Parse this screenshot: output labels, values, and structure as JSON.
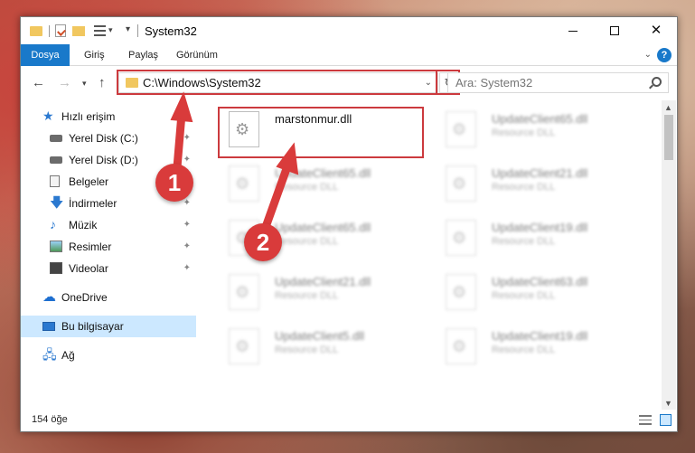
{
  "window": {
    "title": "System32",
    "controls": {
      "minimize": "",
      "maximize": "",
      "close": "✕"
    }
  },
  "ribbon": {
    "tabs": [
      "Dosya",
      "Giriş",
      "Paylaş",
      "Görünüm"
    ],
    "help": "?"
  },
  "address": {
    "path": "C:\\Windows\\System32",
    "refresh": "↻"
  },
  "search": {
    "placeholder": "Ara: System32"
  },
  "sidebar": {
    "items": [
      {
        "label": "Hızlı erişim",
        "icon": "star-icon",
        "pinned": false
      },
      {
        "label": "Yerel Disk (C:)",
        "icon": "disk-icon",
        "pinned": true
      },
      {
        "label": "Yerel Disk (D:)",
        "icon": "disk-icon",
        "pinned": true
      },
      {
        "label": "Belgeler",
        "icon": "documents-icon",
        "pinned": true
      },
      {
        "label": "İndirmeler",
        "icon": "downloads-icon",
        "pinned": true
      },
      {
        "label": "Müzik",
        "icon": "music-icon",
        "pinned": true
      },
      {
        "label": "Resimler",
        "icon": "pictures-icon",
        "pinned": true
      },
      {
        "label": "Videolar",
        "icon": "videos-icon",
        "pinned": true
      },
      {
        "label": "OneDrive",
        "icon": "cloud-icon",
        "pinned": false
      },
      {
        "label": "Bu bilgisayar",
        "icon": "computer-icon",
        "pinned": false,
        "selected": true
      },
      {
        "label": "Ağ",
        "icon": "network-icon",
        "pinned": false
      }
    ]
  },
  "files": {
    "highlighted": {
      "name": "marstonmur.dll",
      "type": ""
    },
    "blurred": [
      {
        "name": "UpdateClient65.dll",
        "type": "Resource DLL"
      },
      {
        "name": "UpdateClient65.dll",
        "type": "Resource DLL"
      },
      {
        "name": "UpdateClient21.dll",
        "type": "Resource DLL"
      },
      {
        "name": "UpdateClient65.dll",
        "type": "Resource DLL"
      },
      {
        "name": "UpdateClient19.dll",
        "type": "Resource DLL"
      },
      {
        "name": "UpdateClient21.dll",
        "type": "Resource DLL"
      },
      {
        "name": "UpdateClient63.dll",
        "type": "Resource DLL"
      },
      {
        "name": "UpdateClient5.dll",
        "type": "Resource DLL"
      },
      {
        "name": "UpdateClient19.dll",
        "type": "Resource DLL"
      }
    ]
  },
  "status": {
    "item_count": "154 öğe"
  },
  "annotations": {
    "step1": "1",
    "step2": "2",
    "color": "#d93b3b"
  },
  "colors": {
    "accent": "#1979ca",
    "highlight": "#cc3a3e",
    "selected": "#cce8ff"
  }
}
